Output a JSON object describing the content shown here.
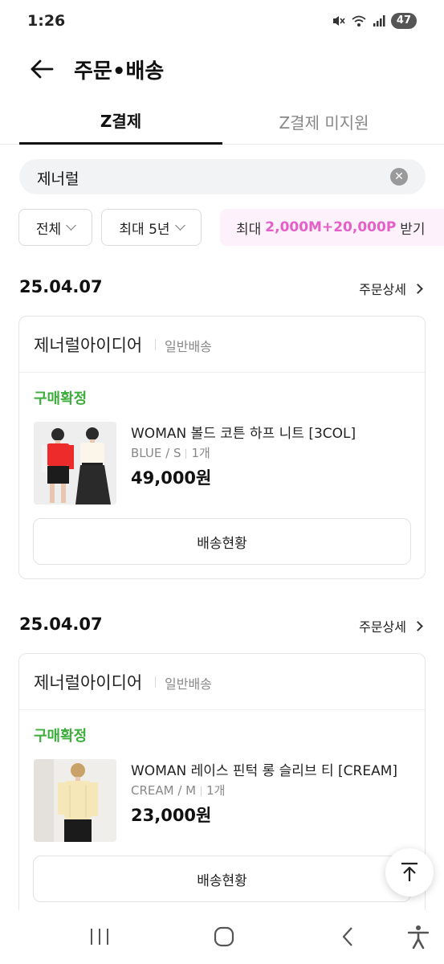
{
  "status_bar": {
    "time": "1:26",
    "battery": "47",
    "icons": [
      "mute-icon",
      "wifi-icon",
      "signal-icon",
      "battery-icon"
    ]
  },
  "header": {
    "title": "주문•배송",
    "back_icon": "arrow-left-icon"
  },
  "tabs": [
    {
      "label": "Z결제",
      "active": true
    },
    {
      "label": "Z결제 미지원",
      "active": false
    }
  ],
  "search": {
    "value": "제너럴",
    "clear_icon": "clear-icon"
  },
  "filters": {
    "status": "전체",
    "period": "최대 5년",
    "promo": {
      "prefix": "최대",
      "highlight": "2,000M+20,000P",
      "suffix": "받기"
    }
  },
  "orders": [
    {
      "date": "25.04.07",
      "detail_label": "주문상세",
      "seller": "제너럴아이디어",
      "shipping": "일반배송",
      "status": "구매확정",
      "product_name": "WOMAN 볼드 코튼 하프 니트 [3COL]",
      "option": "BLUE / S",
      "quantity": "1개",
      "price": "49,000원",
      "track_label": "배송현황"
    },
    {
      "date": "25.04.07",
      "detail_label": "주문상세",
      "seller": "제너럴아이디어",
      "shipping": "일반배송",
      "status": "구매확정",
      "product_name": "WOMAN 레이스 핀턱 롱 슬리브 티 [CREAM]",
      "option": "CREAM / M",
      "quantity": "1개",
      "price": "23,000원",
      "track_label": "배송현황"
    }
  ],
  "colors": {
    "status_green": "#3dae3c",
    "promo_pink": "#e45fc8",
    "promo_bg": "#fdf2fb"
  },
  "nav": [
    "recent-apps-icon",
    "home-icon",
    "back-icon",
    "accessibility-icon"
  ]
}
